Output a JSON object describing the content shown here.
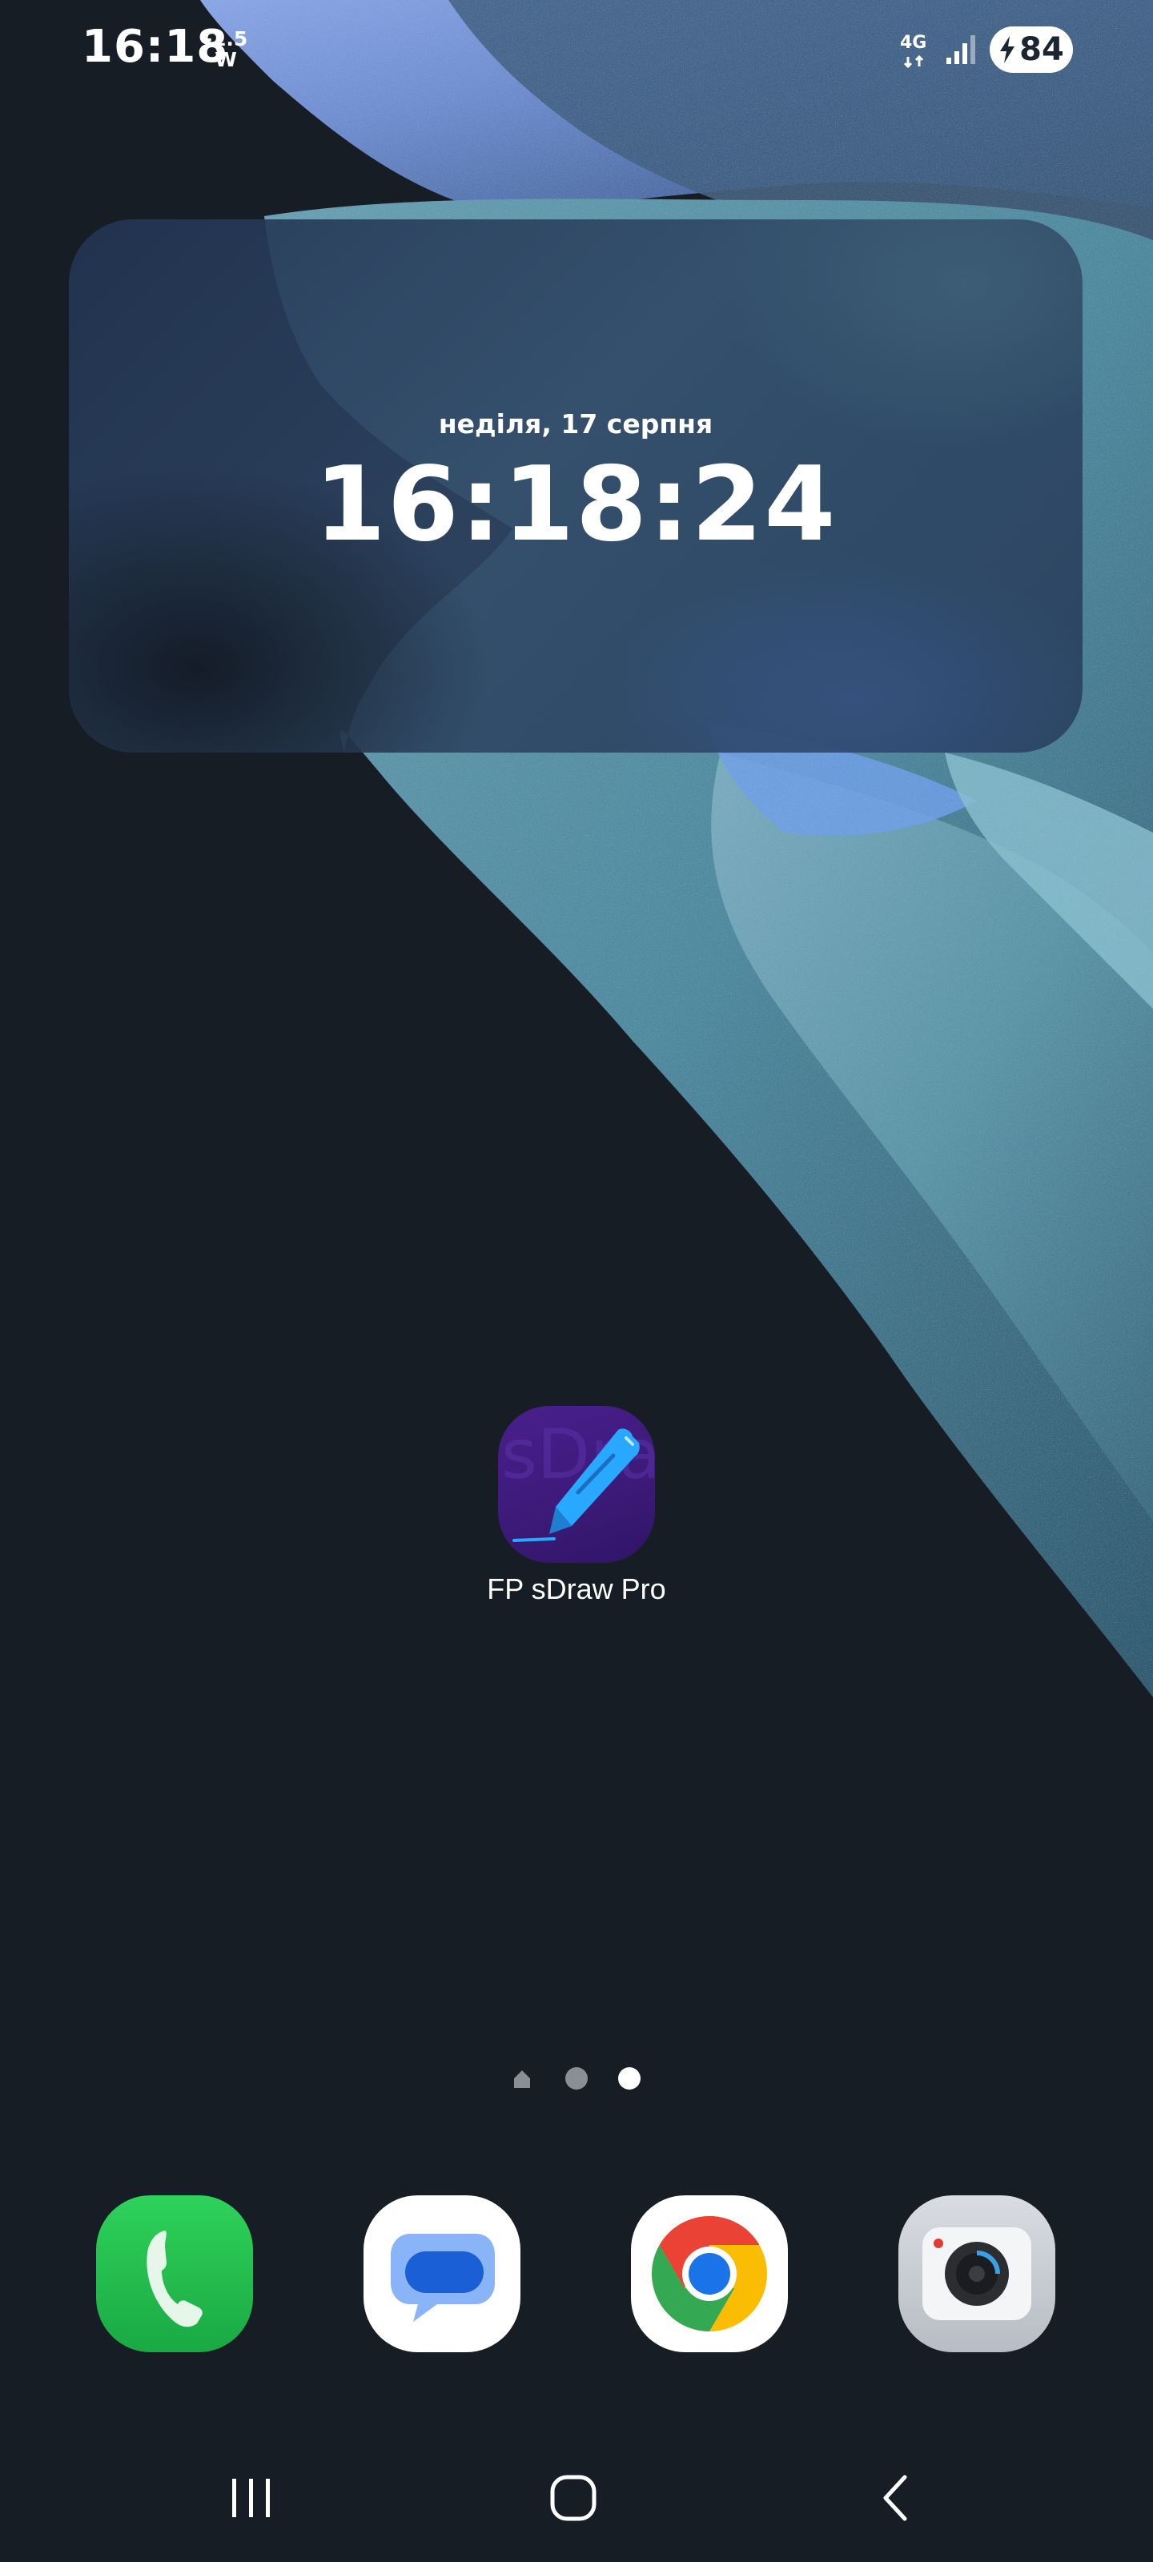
{
  "status_bar": {
    "time": "16:18",
    "power_value": "-1.5",
    "power_unit": "W",
    "network": "4G",
    "battery_level": "84"
  },
  "widget": {
    "date": "неділя, 17 серпня",
    "time": "16:18:24"
  },
  "home_apps": [
    {
      "label": "FP sDraw Pro",
      "icon": "pen-drawing-icon",
      "watermark": "sDra"
    }
  ],
  "page_indicator": {
    "pages": 3,
    "current": 3
  },
  "dock": [
    {
      "name": "phone",
      "icon": "phone-icon"
    },
    {
      "name": "messages",
      "icon": "message-icon"
    },
    {
      "name": "chrome",
      "icon": "chrome-icon"
    },
    {
      "name": "camera",
      "icon": "camera-icon"
    }
  ],
  "nav_bar": [
    "recents",
    "home",
    "back"
  ],
  "colors": {
    "background": "#171d24",
    "phone_green": "#1fb94a",
    "messages_blue": "#1a73e8",
    "app_purple": "#3b1a78",
    "pen_blue": "#29a8ff"
  }
}
